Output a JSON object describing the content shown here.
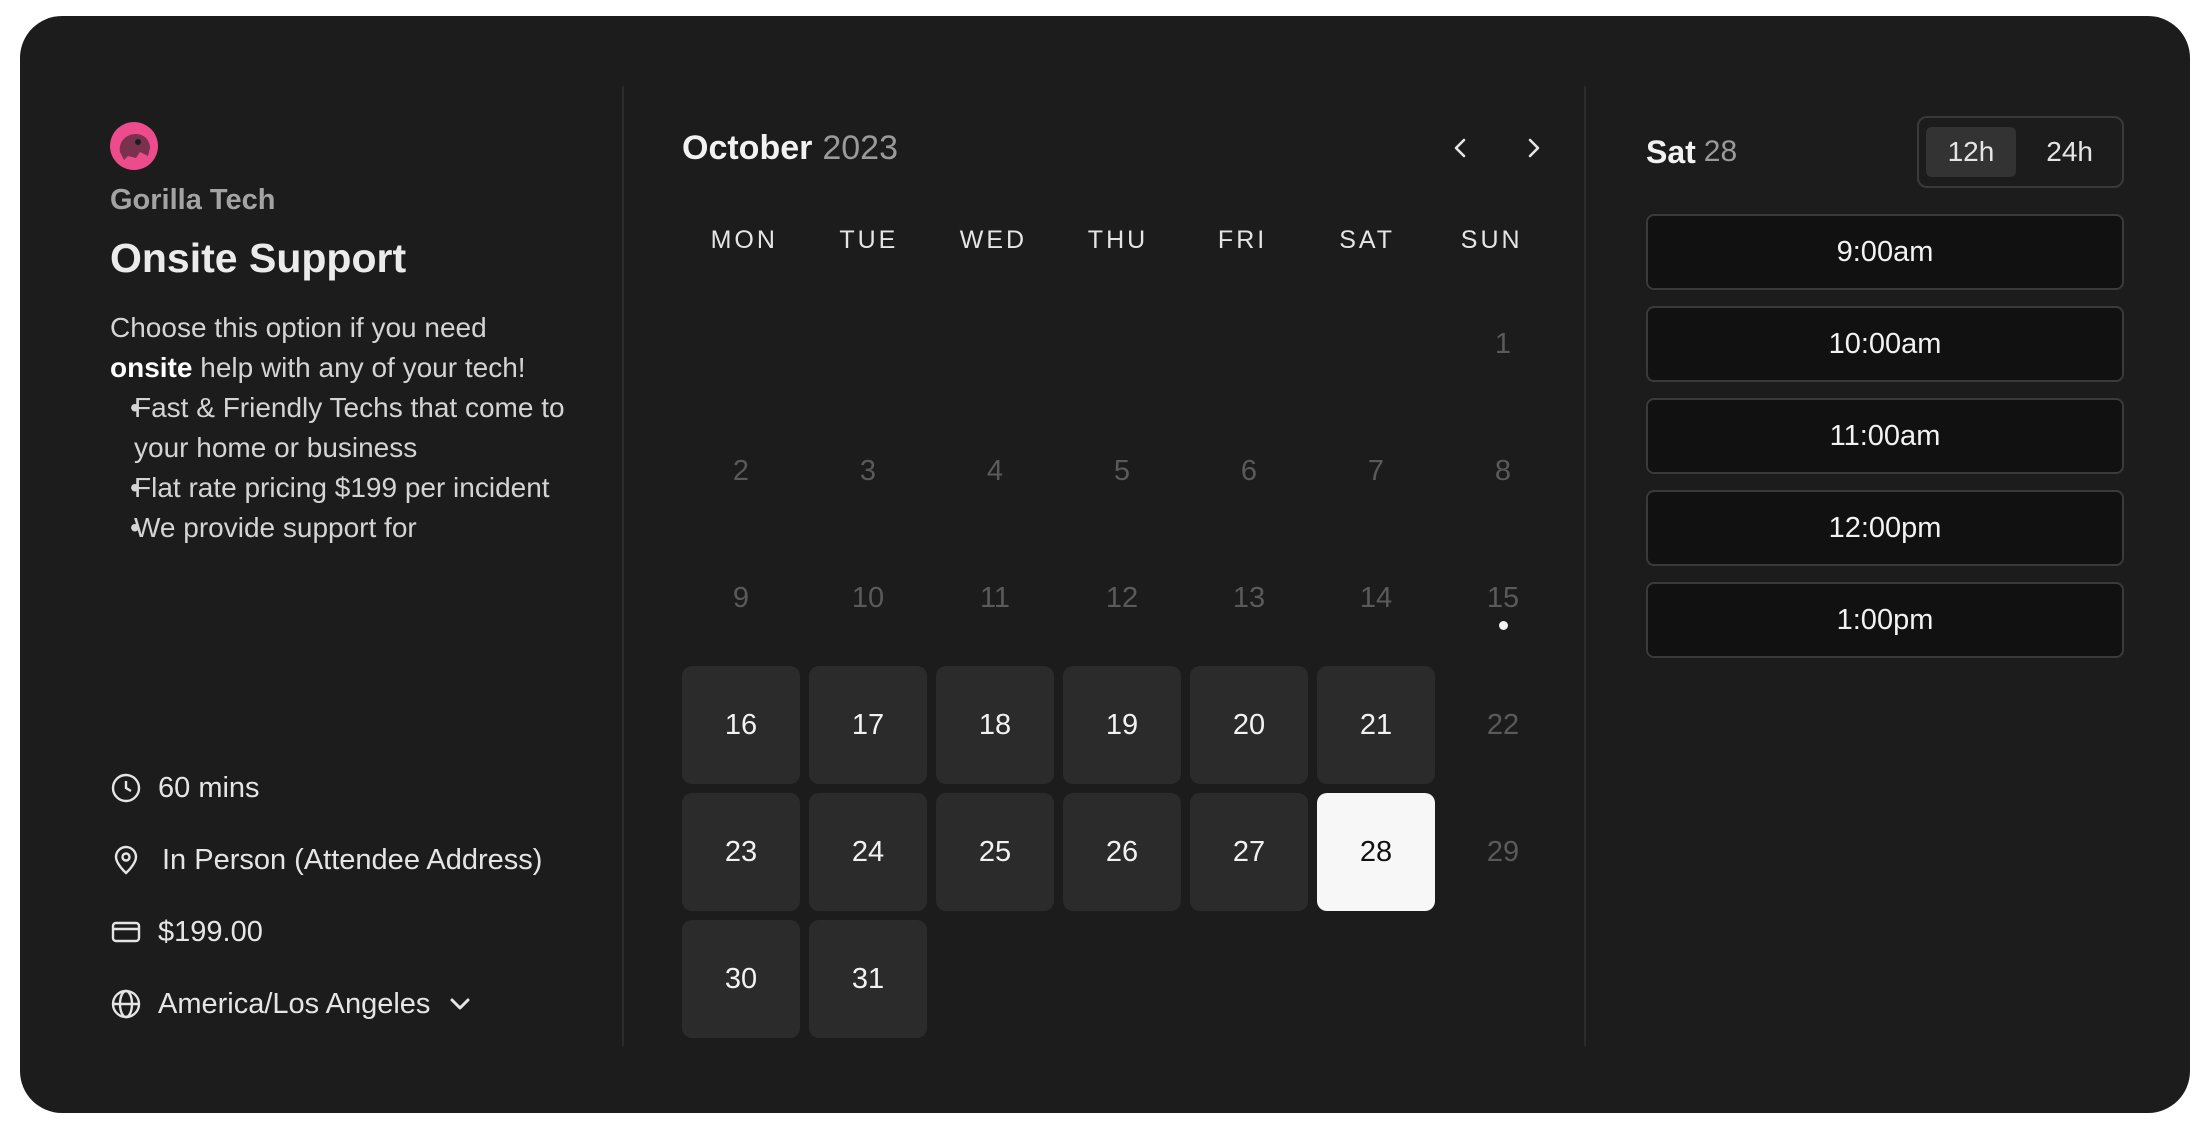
{
  "profile": {
    "org_name": "Gorilla Tech",
    "event_title": "Onsite Support",
    "desc_line1": "Choose this option if you need",
    "desc_bold": "onsite",
    "desc_rest": " help with any of your tech!",
    "bullets": [
      "Fast & Friendly Techs that come to your home or business",
      "Flat rate pricing $199 per incident",
      "We provide support for"
    ],
    "duration": "60 mins",
    "location": "In Person (Attendee Address)",
    "price": "$199.00",
    "timezone": "America/Los Angeles",
    "brand_color": "#ec4c8b"
  },
  "calendar": {
    "month": "October",
    "year": "2023",
    "weekdays": [
      "MON",
      "TUE",
      "WED",
      "THU",
      "FRI",
      "SAT",
      "SUN"
    ],
    "leading_blanks": 6,
    "days": [
      {
        "n": "1",
        "state": "off"
      },
      {
        "n": "2",
        "state": "off"
      },
      {
        "n": "3",
        "state": "off"
      },
      {
        "n": "4",
        "state": "off"
      },
      {
        "n": "5",
        "state": "off"
      },
      {
        "n": "6",
        "state": "off"
      },
      {
        "n": "7",
        "state": "off"
      },
      {
        "n": "8",
        "state": "off"
      },
      {
        "n": "9",
        "state": "off"
      },
      {
        "n": "10",
        "state": "off"
      },
      {
        "n": "11",
        "state": "off"
      },
      {
        "n": "12",
        "state": "off"
      },
      {
        "n": "13",
        "state": "off"
      },
      {
        "n": "14",
        "state": "off"
      },
      {
        "n": "15",
        "state": "off",
        "today": true
      },
      {
        "n": "16",
        "state": "on"
      },
      {
        "n": "17",
        "state": "on"
      },
      {
        "n": "18",
        "state": "on"
      },
      {
        "n": "19",
        "state": "on"
      },
      {
        "n": "20",
        "state": "on"
      },
      {
        "n": "21",
        "state": "on"
      },
      {
        "n": "22",
        "state": "off"
      },
      {
        "n": "23",
        "state": "on"
      },
      {
        "n": "24",
        "state": "on"
      },
      {
        "n": "25",
        "state": "on"
      },
      {
        "n": "26",
        "state": "on"
      },
      {
        "n": "27",
        "state": "on"
      },
      {
        "n": "28",
        "state": "sel"
      },
      {
        "n": "29",
        "state": "off"
      },
      {
        "n": "30",
        "state": "on"
      },
      {
        "n": "31",
        "state": "on"
      }
    ]
  },
  "slots": {
    "selected_weekday": "Sat",
    "selected_day": "28",
    "format_12h": "12h",
    "format_24h": "24h",
    "active_format": "12h",
    "times": [
      "9:00am",
      "10:00am",
      "11:00am",
      "12:00pm",
      "1:00pm"
    ]
  }
}
